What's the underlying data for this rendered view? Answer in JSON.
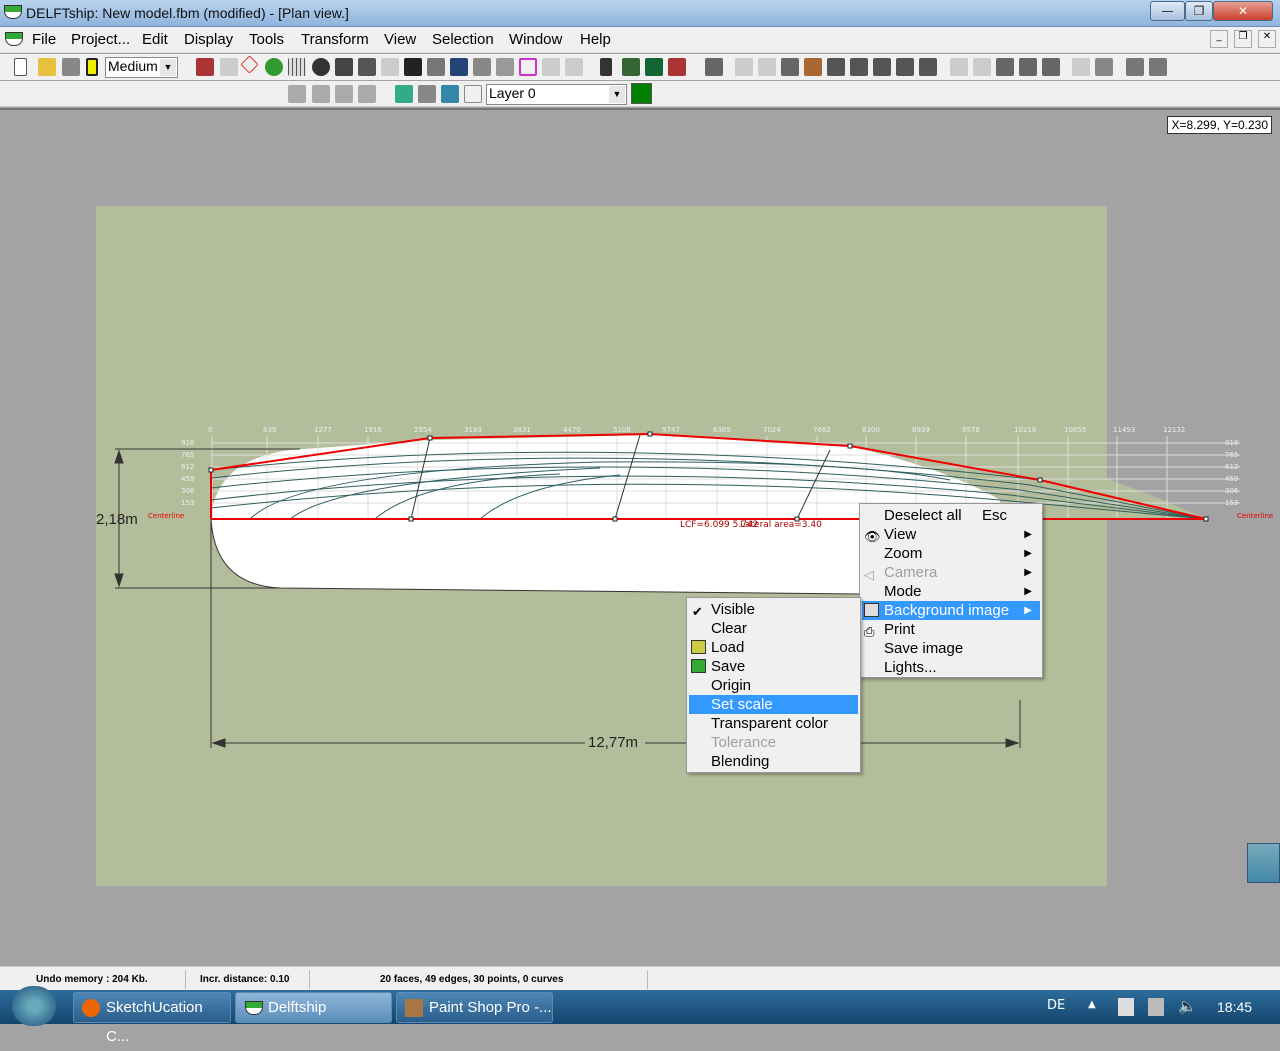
{
  "window": {
    "title": "DELFTship: New model.fbm (modified) - [Plan view.]"
  },
  "menubar": {
    "items": [
      "File",
      "Project...",
      "Edit",
      "Display",
      "Tools",
      "Transform",
      "View",
      "Selection",
      "Window",
      "Help"
    ]
  },
  "toolbar": {
    "precision_select": "Medium",
    "layer_select": "Layer 0",
    "layer_color": "#008000"
  },
  "viewport": {
    "coords": "X=8.299,  Y=0.230",
    "station_labels": [
      "0",
      "639",
      "1277",
      "1916",
      "2554",
      "3193",
      "3831",
      "4470",
      "5108",
      "5747",
      "6385",
      "7024",
      "7662",
      "8300",
      "8939",
      "9578",
      "10216",
      "10855",
      "11493",
      "12132"
    ],
    "waterline_labels": [
      "918",
      "765",
      "612",
      "459",
      "306",
      "153"
    ],
    "centerline_label": "Centerline",
    "height_dimension": "2,18m",
    "length_dimension": "12,77m",
    "lcf_text": "LCF=6.099 5.742",
    "lateral_area_text": "Lateral area=3.40"
  },
  "context_menu": {
    "items": [
      {
        "label": "Deselect all",
        "shortcut": "Esc"
      },
      {
        "label": "View",
        "icon": "eye-icon",
        "submenu": true
      },
      {
        "label": "Zoom",
        "submenu": true
      },
      {
        "label": "Camera",
        "icon": "camera-icon",
        "submenu": true,
        "disabled": true
      },
      {
        "label": "Mode",
        "submenu": true
      },
      {
        "label": "Background image",
        "icon": "background-image-icon",
        "submenu": true,
        "highlighted": true
      },
      {
        "label": "Print",
        "icon": "printer-icon"
      },
      {
        "label": "Save image"
      },
      {
        "label": "Lights..."
      }
    ]
  },
  "submenu": {
    "items": [
      {
        "label": "Visible",
        "checked": true
      },
      {
        "label": "Clear"
      },
      {
        "label": "Load",
        "icon": "load-image-icon"
      },
      {
        "label": "Save",
        "icon": "save-image-icon"
      },
      {
        "label": "Origin"
      },
      {
        "label": "Set scale",
        "highlighted": true
      },
      {
        "label": "Transparent color"
      },
      {
        "label": "Tolerance",
        "disabled": true
      },
      {
        "label": "Blending"
      }
    ]
  },
  "statusbar": {
    "undo": "Undo memory : 204 Kb.",
    "incr": "Incr. distance: 0.10",
    "counts": "20 faces, 49 edges, 30 points, 0 curves"
  },
  "taskbar": {
    "items": [
      "SketchUcation C...",
      "Delftship",
      "Paint Shop Pro -..."
    ],
    "lang": "DE",
    "time": "18:45"
  }
}
